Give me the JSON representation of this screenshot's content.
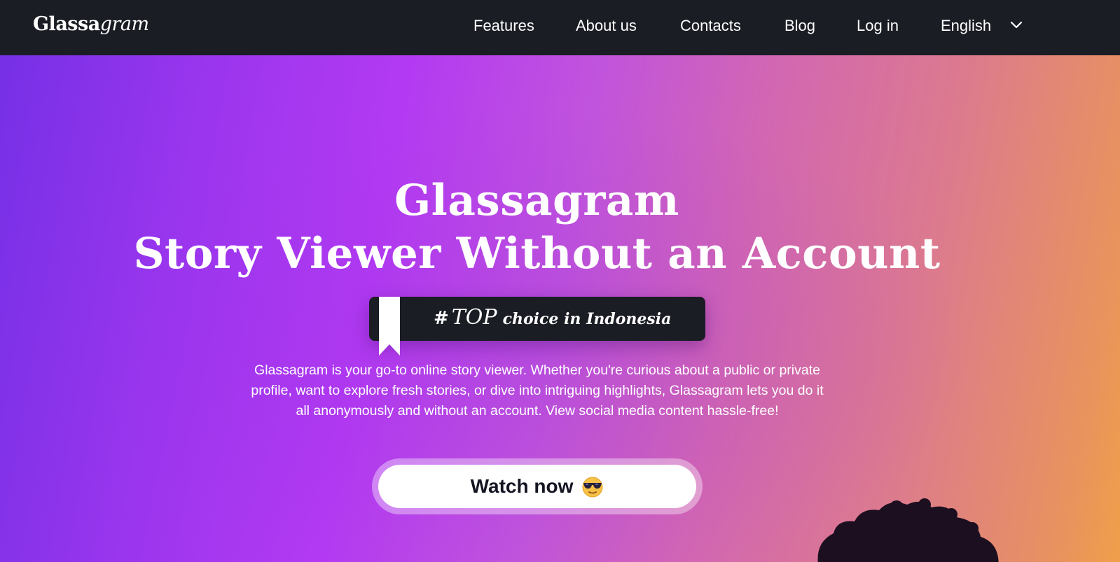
{
  "brand": {
    "logo_bold": "Glassa",
    "logo_italic": "gram"
  },
  "nav": {
    "items": [
      {
        "label": "Features"
      },
      {
        "label": "About us"
      },
      {
        "label": "Contacts"
      },
      {
        "label": "Blog"
      },
      {
        "label": "Log in"
      }
    ],
    "language": "English"
  },
  "hero": {
    "title_line1": "Glassagram",
    "title_line2": "Story Viewer Without an Account",
    "badge": {
      "hash": "#",
      "top": "TOP",
      "text": "choice in Indonesia"
    },
    "description": "Glassagram is your go-to online story viewer. Whether you're curious about a public or private profile, want to explore fresh stories, or dive into intriguing highlights, Glassagram lets you do it all anonymously and without an account. View social media content hassle-free!",
    "cta_label": "Watch now",
    "cta_icon": "sunglasses-emoji-icon"
  },
  "colors": {
    "navbar": "#1b1d25",
    "gradient_start": "#7630e6",
    "gradient_mid": "#b33af2",
    "gradient_end": "#f09f4a",
    "cta_text": "#141522"
  }
}
